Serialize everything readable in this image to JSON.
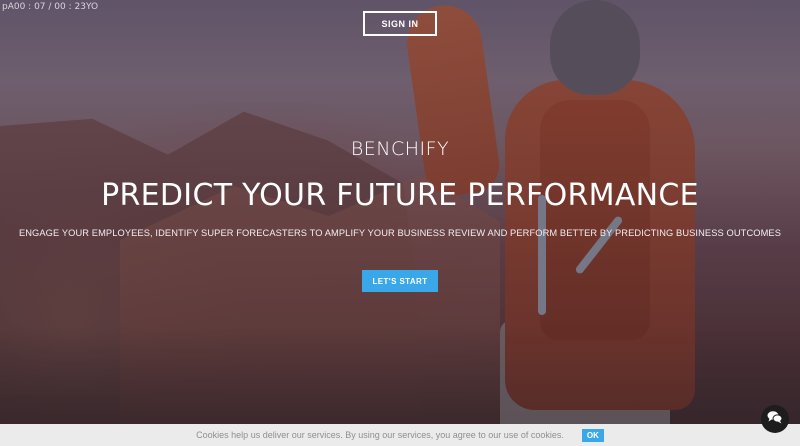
{
  "debug_text": "pA00 : 07 / 00 : 23YO",
  "header": {
    "sign_in_label": "SIGN IN"
  },
  "hero": {
    "brand": "BENCHIFY",
    "headline": "PREDICT YOUR FUTURE PERFORMANCE",
    "subline": "ENGAGE YOUR EMPLOYEES, IDENTIFY SUPER FORECASTERS TO AMPLIFY YOUR BUSINESS REVIEW AND PERFORM BETTER BY PREDICTING BUSINESS OUTCOMES",
    "cta_label": "LET'S START"
  },
  "cookie_bar": {
    "message": "Cookies help us deliver our services. By using our services, you agree to our use of cookies.",
    "ok_label": "OK"
  },
  "chat_widget": {
    "icon": "chat-bubbles-icon"
  },
  "colors": {
    "accent": "#3aa8e8",
    "cookie_bg": "#ecebeb",
    "chat_bg": "#1d1d1d"
  }
}
